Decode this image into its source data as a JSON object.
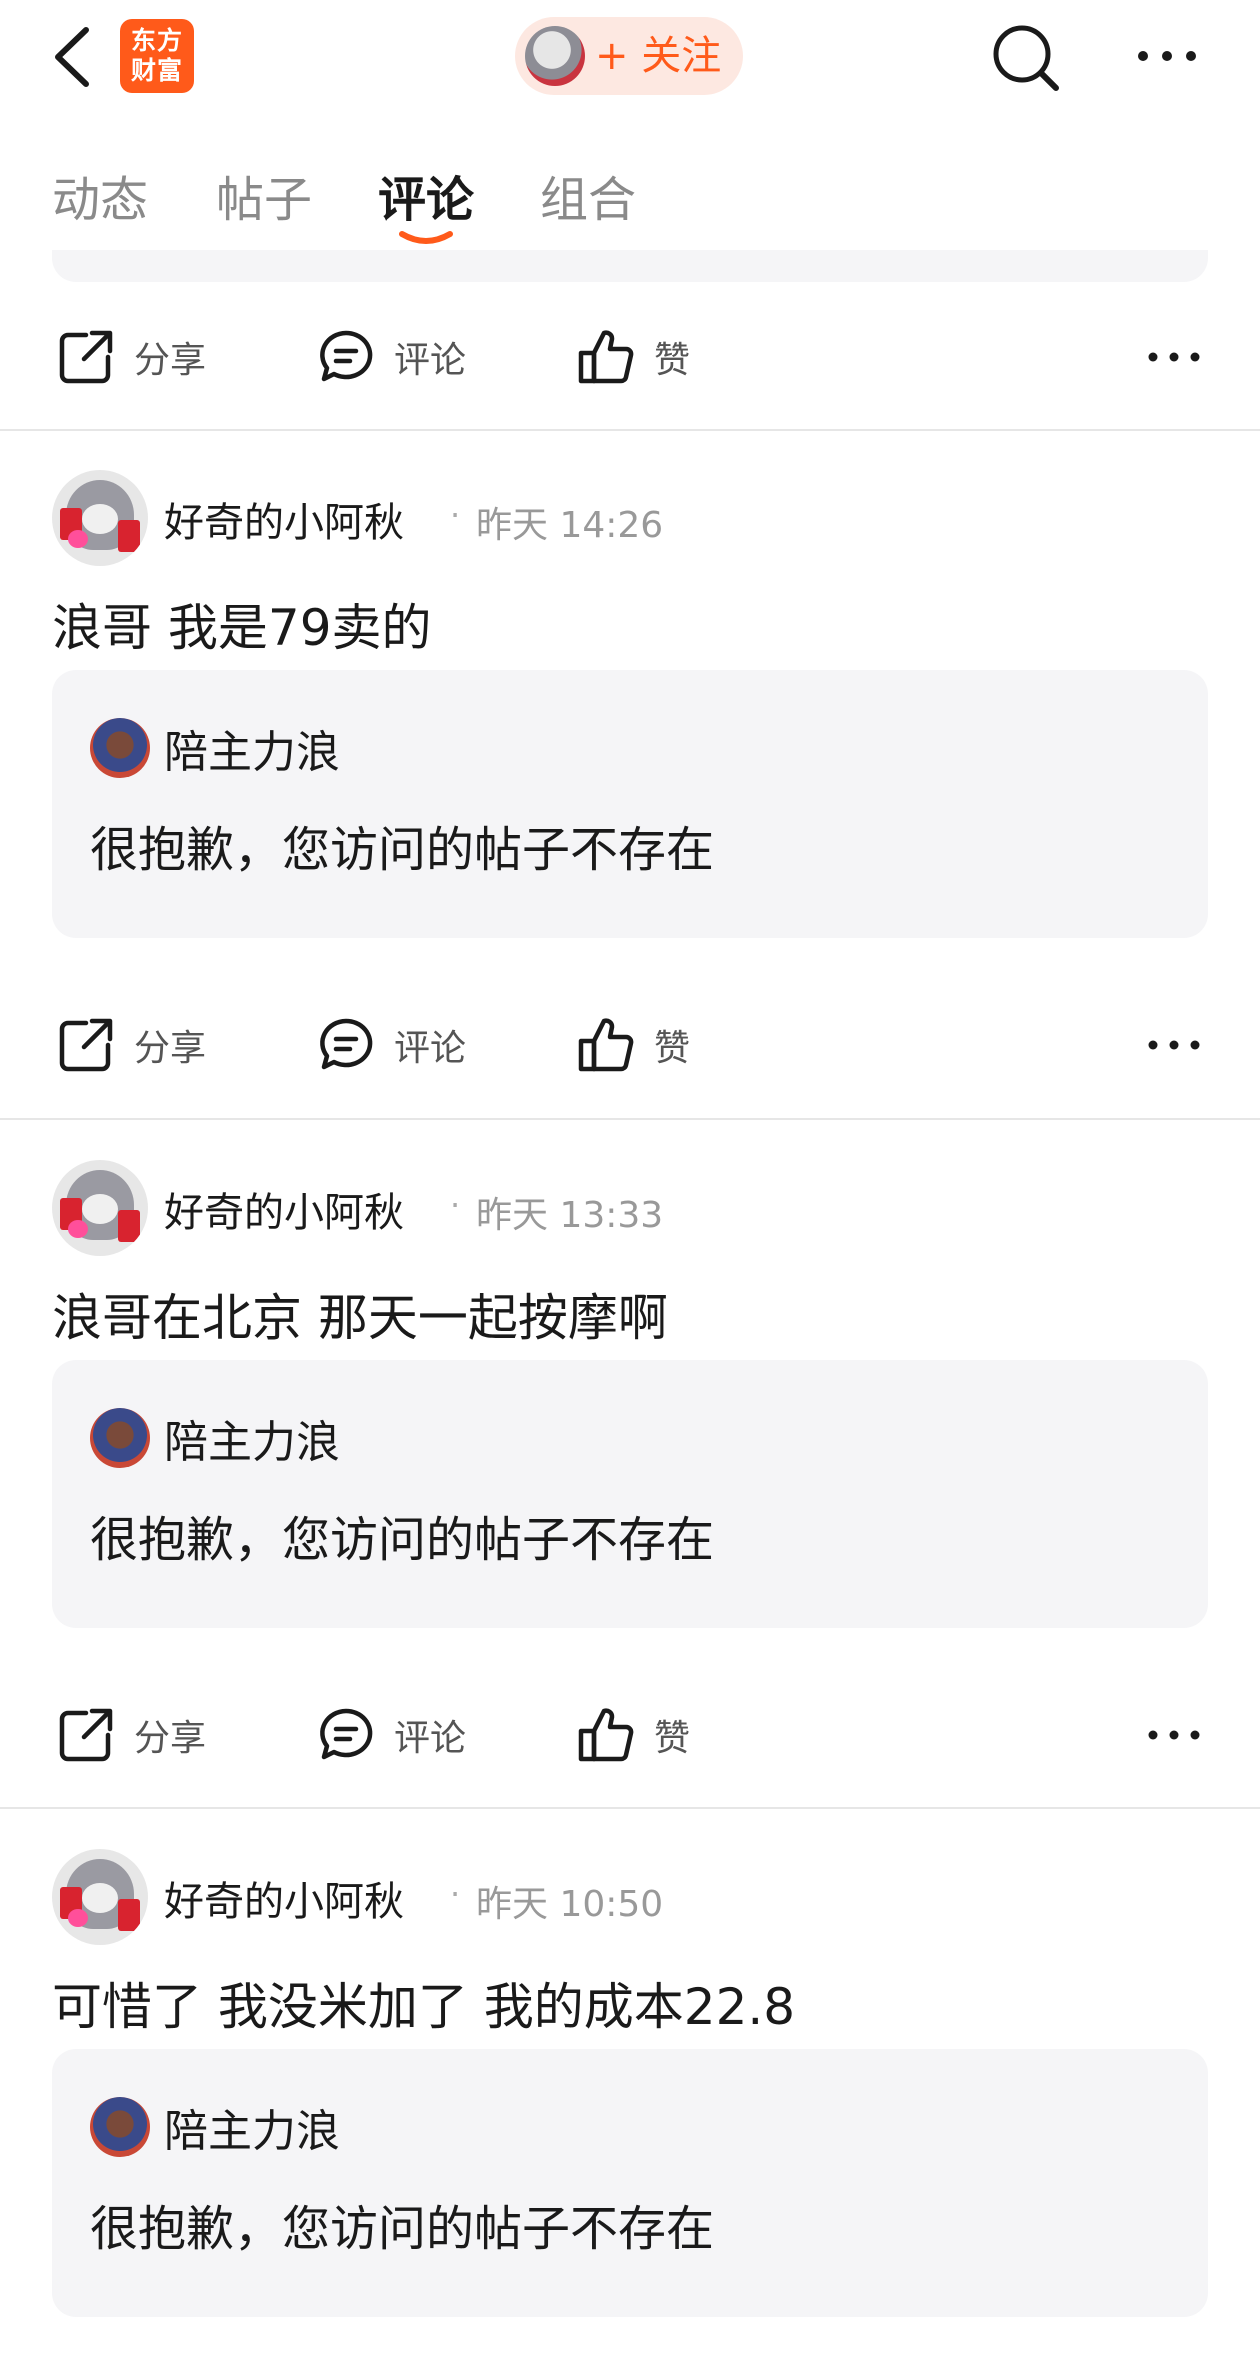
{
  "app": {
    "logo_text_line1": "东方",
    "logo_text_line2": "财富",
    "follow_label": "+ 关注",
    "brand_color": "#ff5a1a"
  },
  "tabs": [
    {
      "label": "动态",
      "active": false
    },
    {
      "label": "帖子",
      "active": false
    },
    {
      "label": "评论",
      "active": true
    },
    {
      "label": "组合",
      "active": false
    }
  ],
  "actions": {
    "share": "分享",
    "comment": "评论",
    "like": "赞"
  },
  "posts": [
    {
      "username": "好奇的小阿秋",
      "separator": "·",
      "time": "昨天 14:26",
      "content": "浪哥 我是79卖的",
      "quote": {
        "author": "陪主力浪",
        "text": "很抱歉，您访问的帖子不存在"
      }
    },
    {
      "username": "好奇的小阿秋",
      "separator": "·",
      "time": "昨天 13:33",
      "content": "浪哥在北京 那天一起按摩啊",
      "quote": {
        "author": "陪主力浪",
        "text": "很抱歉，您访问的帖子不存在"
      }
    },
    {
      "username": "好奇的小阿秋",
      "separator": "·",
      "time": "昨天 10:50",
      "content": "可惜了 我没米加了 我的成本22.8",
      "quote": {
        "author": "陪主力浪",
        "text": "很抱歉，您访问的帖子不存在"
      }
    }
  ]
}
